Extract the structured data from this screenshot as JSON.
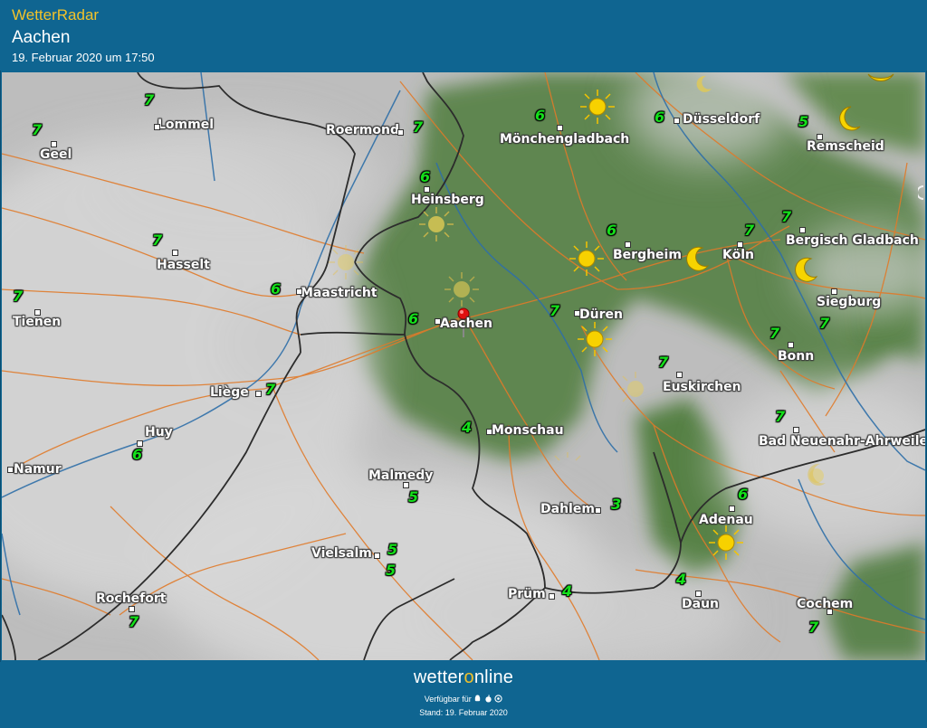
{
  "header": {
    "app_title": "WetterRadar",
    "location": "Aachen",
    "timestamp": "19. Februar 2020 um 17:50"
  },
  "map": {
    "cities": [
      {
        "name": "Lommel"
      },
      {
        "name": "Geel"
      },
      {
        "name": "Roermond"
      },
      {
        "name": "Mönchengladbach"
      },
      {
        "name": "Düsseldorf"
      },
      {
        "name": "Remscheid"
      },
      {
        "name": "Heinsberg"
      },
      {
        "name": "Hasselt"
      },
      {
        "name": "Maastricht"
      },
      {
        "name": "Tienen"
      },
      {
        "name": "Aachen"
      },
      {
        "name": "Düren"
      },
      {
        "name": "Bergheim"
      },
      {
        "name": "Köln"
      },
      {
        "name": "Bergisch Gladbach"
      },
      {
        "name": "Siegburg"
      },
      {
        "name": "Bonn"
      },
      {
        "name": "Liège"
      },
      {
        "name": "Euskirchen"
      },
      {
        "name": "Huy"
      },
      {
        "name": "Monschau"
      },
      {
        "name": "Bad Neuenahr-Ahrweiler"
      },
      {
        "name": "Namur"
      },
      {
        "name": "Malmedy"
      },
      {
        "name": "Dahlem"
      },
      {
        "name": "Adenau"
      },
      {
        "name": "Vielsalm"
      },
      {
        "name": "Rochefort"
      },
      {
        "name": "Prüm"
      },
      {
        "name": "Daun"
      },
      {
        "name": "Cochem"
      }
    ],
    "temperatures": [
      "7",
      "7",
      "7",
      "6",
      "6",
      "5",
      "6",
      "7",
      "6",
      "7",
      "6",
      "7",
      "6",
      "7",
      "7",
      "7",
      "7",
      "7",
      "7",
      "6",
      "4",
      "7",
      "5",
      "3",
      "6",
      "5",
      "5",
      "7",
      "4",
      "4",
      "7"
    ],
    "weather_icons": [
      "sun-icon",
      "sun-icon",
      "sun-icon",
      "sun-icon",
      "sun-icon",
      "sun-icon",
      "sun-icon",
      "sun-icon",
      "sun-icon",
      "sun-icon",
      "moon-icon",
      "moon-icon",
      "moon-icon",
      "moon-icon",
      "moon-icon",
      "moon-icon",
      "moon-icon"
    ],
    "marker": "location-pin-icon"
  },
  "footer": {
    "brand_part1": "wetter",
    "brand_o": "o",
    "brand_part2": "nline",
    "available_label": "Verfügbar für",
    "platforms": [
      "android-icon",
      "apple-icon",
      "web-icon"
    ],
    "stand": "Stand: 19. Februar 2020"
  },
  "colors": {
    "header_bg": "#0f6591",
    "title_yellow": "#f2c22a",
    "temp_green": "#14e01a",
    "forest_green": "#4c7a3a",
    "road_orange": "#e07a2a",
    "river_blue": "#2f6fa8",
    "border_dark": "#2c2c2c"
  }
}
